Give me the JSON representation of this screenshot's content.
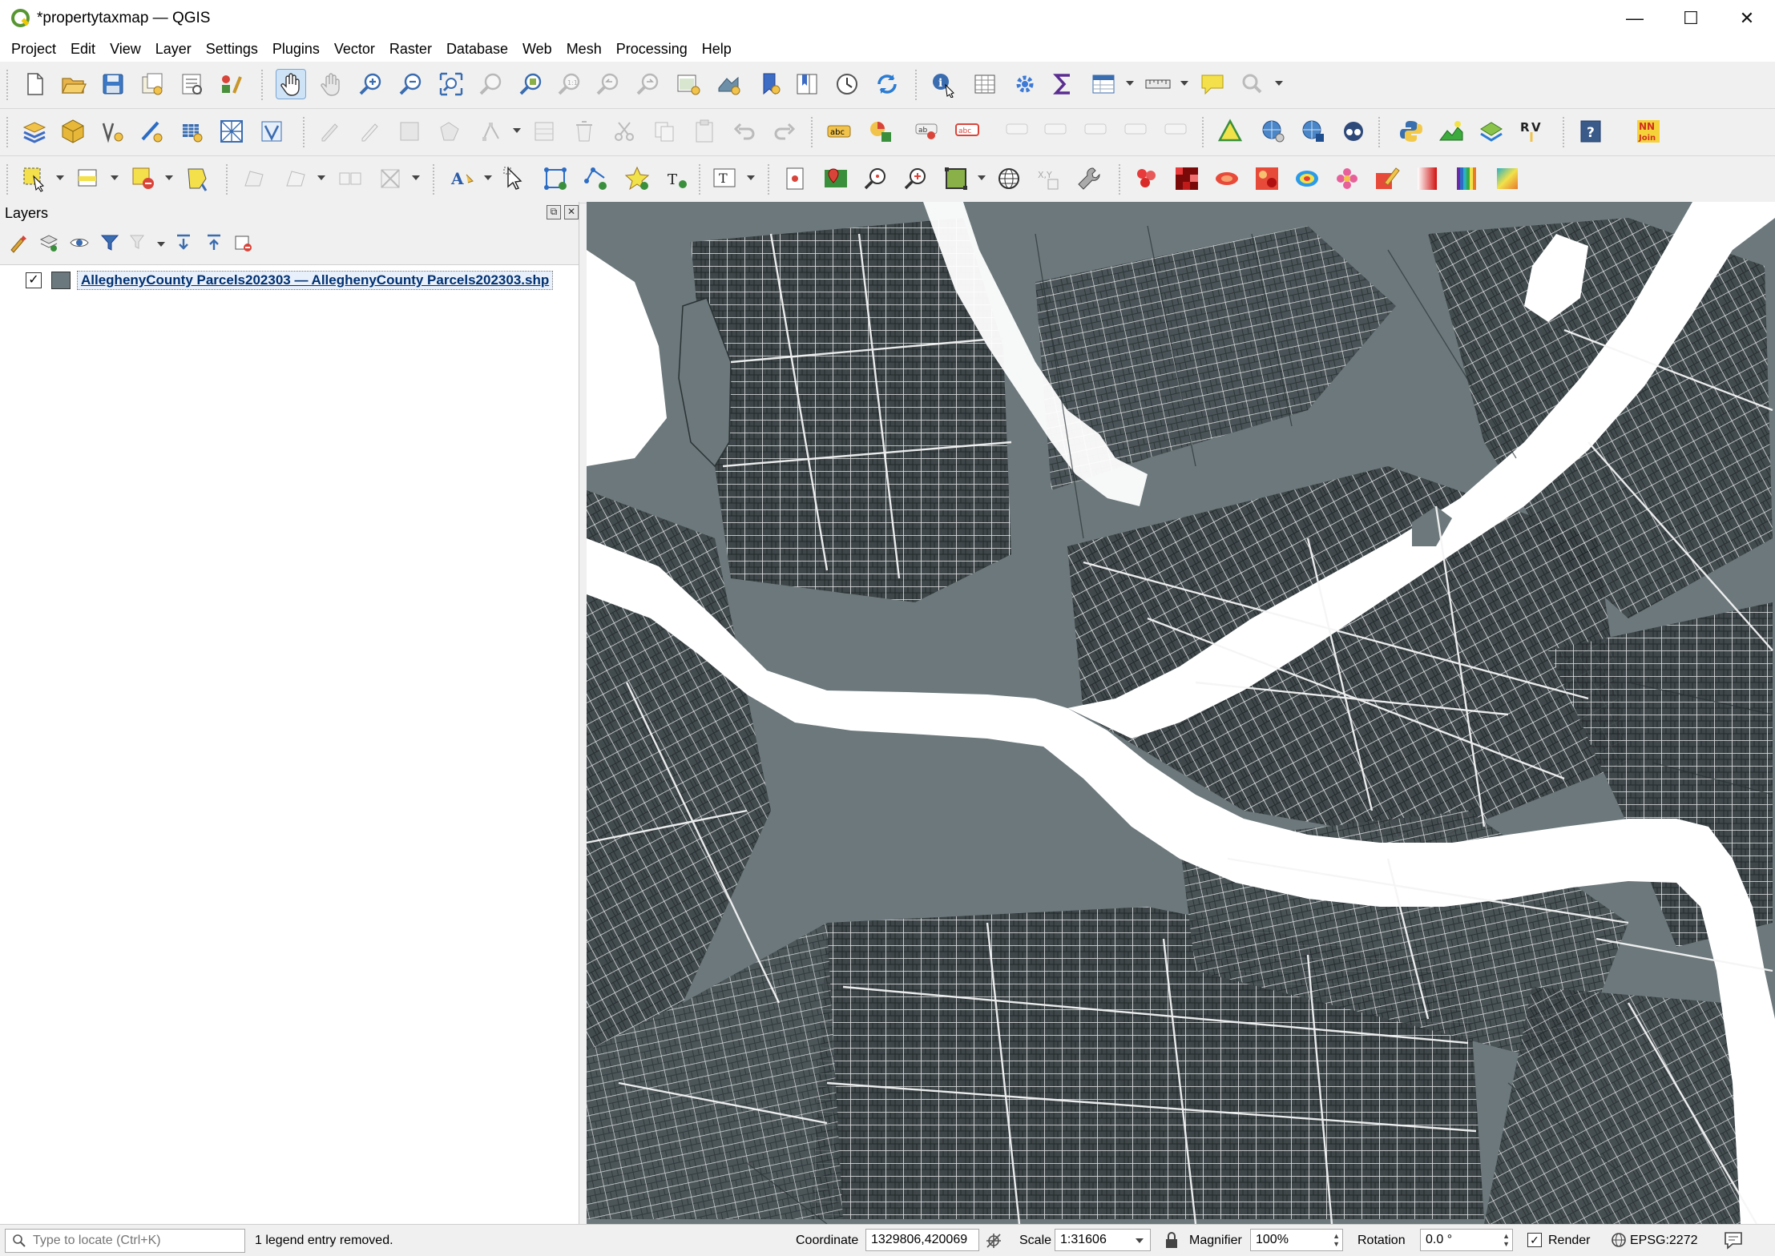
{
  "window": {
    "title": "*propertytaxmap — QGIS",
    "minimize": "—",
    "maximize": "☐",
    "close": "✕"
  },
  "menu": [
    "Project",
    "Edit",
    "View",
    "Layer",
    "Settings",
    "Plugins",
    "Vector",
    "Raster",
    "Database",
    "Web",
    "Mesh",
    "Processing",
    "Help"
  ],
  "layers_panel": {
    "title": "Layers",
    "layers": [
      {
        "name": "AlleghenyCounty Parcels202303 — AlleghenyCounty Parcels202303.shp",
        "checked": "✓",
        "color": "#6b787d"
      }
    ]
  },
  "map": {
    "fill_color": "#6c787c",
    "line_color": "#ffffff"
  },
  "statusbar": {
    "locator_placeholder": "Type to locate (Ctrl+K)",
    "message": "1 legend entry removed.",
    "coordinate_label": "Coordinate",
    "coordinate_value": "1329806,420069",
    "scale_label": "Scale",
    "scale_value": "1:31606",
    "magnifier_label": "Magnifier",
    "magnifier_value": "100%",
    "rotation_label": "Rotation",
    "rotation_value": "0.0 °",
    "render_label": "Render",
    "render_checked": "✓",
    "crs": "EPSG:2272"
  }
}
